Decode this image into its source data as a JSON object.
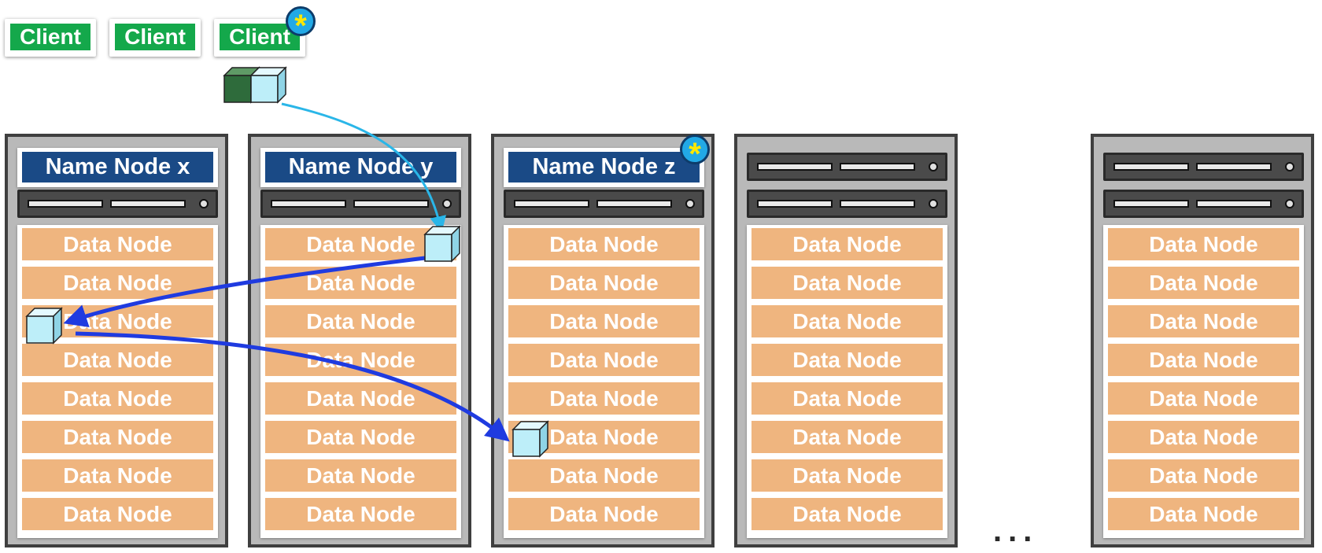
{
  "clients": [
    "Client",
    "Client",
    "Client"
  ],
  "racks": [
    {
      "name_node": "Name Node x"
    },
    {
      "name_node": "Name Node y"
    },
    {
      "name_node": "Name Node z"
    },
    {
      "name_node": ""
    },
    {
      "name_node": ""
    }
  ],
  "data_node_label": "Data Node",
  "data_nodes_per_rack": 8,
  "ellipsis": "...",
  "star_badge": "*",
  "colors": {
    "client": "#14a84b",
    "name_node": "#1a4a86",
    "data_node": "#efb57f",
    "rack": "#b9b9b9",
    "star_badge": "#22a9e6",
    "star": "#ffe800",
    "client_arrow": "#2ab6e8",
    "replication_arrow": "#1f3be0",
    "block": "#bdeef9"
  },
  "icons": [
    "star-badge-icon",
    "data-block-icon",
    "server-unit-icon",
    "arrow-icon"
  ]
}
